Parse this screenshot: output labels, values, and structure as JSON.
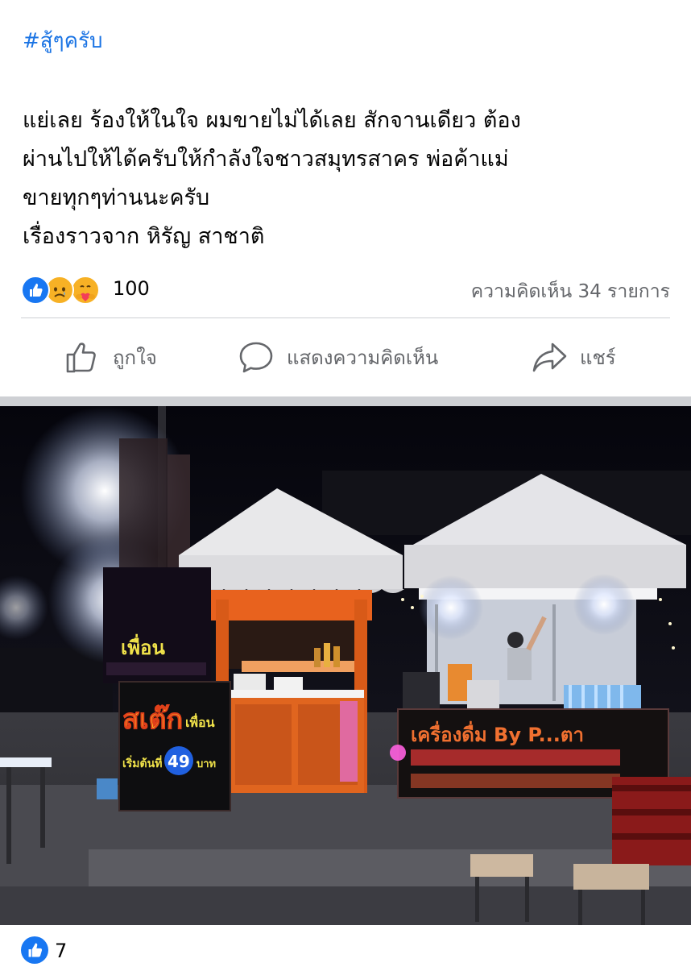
{
  "post": {
    "hashtag": "#สู้ๆครับ",
    "lines": [
      "แย่เลย ร้องให้ในใจ ผมขายไม่ได้เลย สักจานเดียว ต้อง",
      "ผ่านไปให้ได้ครับให้กำลังใจชาวสมุทรสาคร พ่อค้าแม่",
      "ขายทุกๆท่านนะครับ",
      "เรื่องราวจาก หิรัญ สาชาติ"
    ],
    "reaction_count": "100",
    "comment_count": "ความคิดเห็น 34 รายการ"
  },
  "actions": {
    "like": "ถูกใจ",
    "comment": "แสดงความคิดเห็น",
    "share": "แชร์"
  },
  "photo": {
    "sign_left_top": "เพื่อน",
    "sign_left_main": "สเต๊ก",
    "sign_left_sub": "เพื่อน",
    "sign_left_price_label": "เริ่มต้นที่",
    "sign_left_price": "49",
    "sign_left_unit": "บาท",
    "sign_right": "เครื่องดื่ม By P...ตา"
  },
  "footer": {
    "like_count": "7"
  },
  "colors": {
    "link": "#1b74e4",
    "like_blue": "#1877f2",
    "muted": "#65676b"
  },
  "icons": [
    "like-reaction-icon",
    "sad-reaction-icon",
    "care-reaction-icon",
    "thumbs-up-icon",
    "comment-bubble-icon",
    "share-arrow-icon"
  ]
}
